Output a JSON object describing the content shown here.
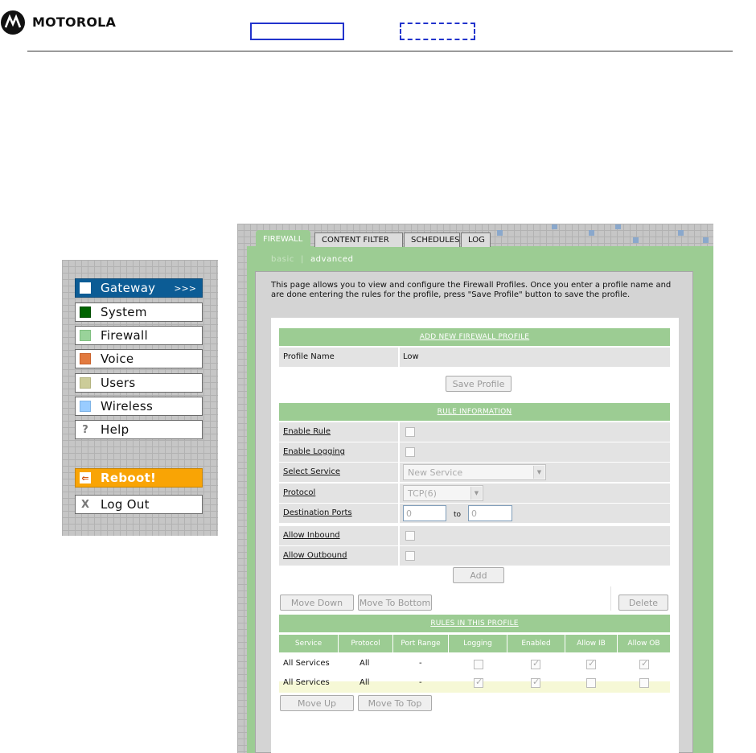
{
  "header": {
    "brand": "MOTOROLA"
  },
  "nav": {
    "items": [
      {
        "label": "Gateway",
        "color": "#ffffff",
        "active": true,
        "arrows": ">>>"
      },
      {
        "label": "System",
        "color": "#006400"
      },
      {
        "label": "Firewall",
        "color": "#99d39a"
      },
      {
        "label": "Voice",
        "color": "#e27a3f"
      },
      {
        "label": "Users",
        "color": "#cccc99"
      },
      {
        "label": "Wireless",
        "color": "#99ccff"
      },
      {
        "label": "Help",
        "glyph": "?"
      }
    ],
    "reboot": {
      "label": "Reboot!",
      "glyph": "⇐"
    },
    "logout": {
      "label": "Log Out",
      "glyph": "X"
    }
  },
  "tabs": [
    "FIREWALL",
    "CONTENT FILTER",
    "SCHEDULES",
    "LOG"
  ],
  "subtabs": {
    "basic": "basic",
    "advanced": "advanced"
  },
  "intro": "This page allows you to view and configure the Firewall Profiles. Once you enter a profile name and are done entering the rules for the profile, press \"Save Profile\" button to save the profile.",
  "profile": {
    "section_title": "ADD NEW FIREWALL PROFILE",
    "name_label": "Profile Name",
    "name_value": "Low",
    "save_button": "Save Profile"
  },
  "rule": {
    "section_title": "RULE INFORMATION",
    "enable_rule": "Enable Rule",
    "enable_logging": "Enable Logging",
    "select_service": "Select Service",
    "service_value": "New Service",
    "protocol": "Protocol",
    "protocol_value": "TCP(6)",
    "dest_ports": "Destination Ports",
    "port_from": "0",
    "port_to_label": "to",
    "port_to": "0",
    "allow_inbound": "Allow Inbound",
    "allow_outbound": "Allow Outbound",
    "add_button": "Add"
  },
  "actions": {
    "move_down": "Move Down",
    "move_bottom": "Move To Bottom",
    "delete": "Delete",
    "move_up": "Move Up",
    "move_top": "Move To Top"
  },
  "rules_table": {
    "section_title": "RULES IN THIS PROFILE",
    "headers": [
      "Service",
      "Protocol",
      "Port Range",
      "Logging",
      "Enabled",
      "Allow IB",
      "Allow OB"
    ],
    "rows": [
      {
        "service": "All Services",
        "protocol": "All",
        "port_range": "-",
        "logging": false,
        "enabled": true,
        "allow_ib": true,
        "allow_ob": true
      },
      {
        "service": "All Services",
        "protocol": "All",
        "port_range": "-",
        "logging": true,
        "enabled": true,
        "allow_ib": false,
        "allow_ob": false
      }
    ]
  }
}
